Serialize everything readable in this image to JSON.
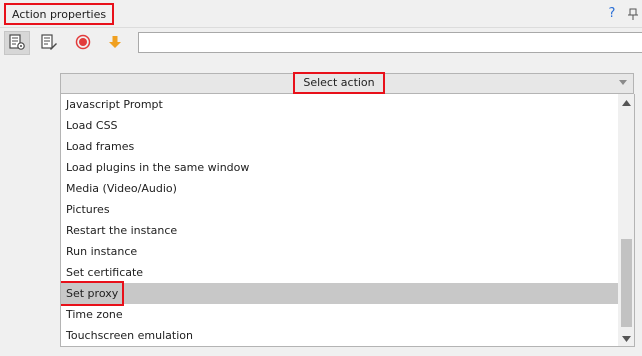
{
  "window": {
    "title": "Action properties",
    "help_label": "?",
    "icons": {
      "help": "help-icon",
      "pin": "pin-icon"
    }
  },
  "toolbar": {
    "buttons": [
      {
        "icon": "properties-settings-icon",
        "active": true
      },
      {
        "icon": "edit-document-icon",
        "active": false
      },
      {
        "icon": "record-icon",
        "color": "#e23b3b"
      },
      {
        "icon": "arrow-down-icon",
        "color": "#f0a020"
      }
    ],
    "search_value": ""
  },
  "action_selector": {
    "header_label": "Select action",
    "items": [
      "Javascript Prompt",
      "Load CSS",
      "Load frames",
      "Load plugins in the same window",
      "Media (Video/Audio)",
      "Pictures",
      "Restart the instance",
      "Run instance",
      "Set certificate",
      "Set proxy",
      "Time zone",
      "Touchscreen emulation"
    ],
    "selected": "Set proxy"
  },
  "colors": {
    "highlight": "#e8101a",
    "selection": "#c8c8c8",
    "accent_blue": "#2b6fd6"
  }
}
